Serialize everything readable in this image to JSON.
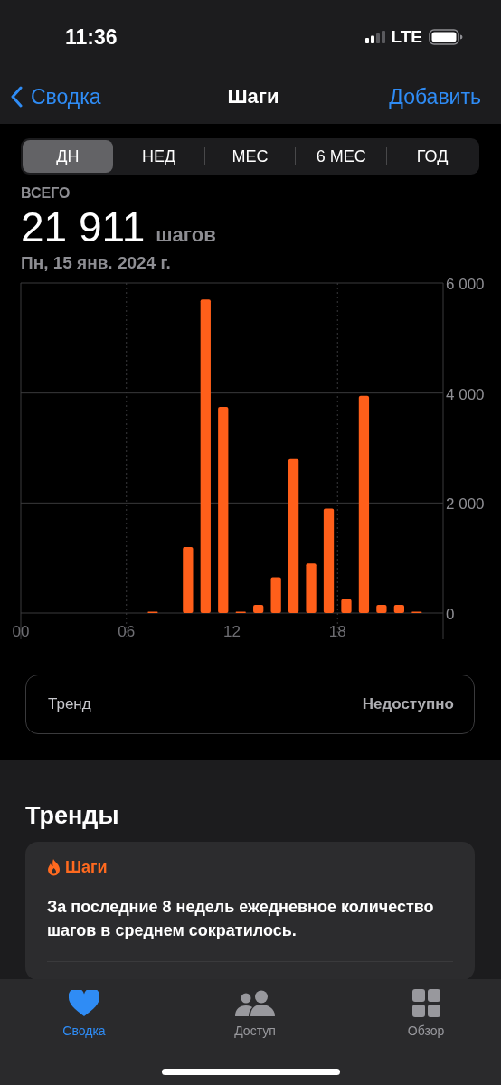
{
  "status_bar": {
    "time": "11:36",
    "network": "LTE"
  },
  "nav": {
    "back": "Сводка",
    "title": "Шаги",
    "action": "Добавить"
  },
  "periods": [
    {
      "label": "ДН",
      "selected": true
    },
    {
      "label": "НЕД",
      "selected": false
    },
    {
      "label": "МЕС",
      "selected": false
    },
    {
      "label": "6 МЕС",
      "selected": false
    },
    {
      "label": "ГОД",
      "selected": false
    }
  ],
  "summary": {
    "caption": "ВСЕГО",
    "value": "21 911",
    "unit": "шагов",
    "date": "Пн, 15 янв. 2024 г."
  },
  "chart": {
    "chart_data": {
      "type": "bar",
      "x": [
        0.5,
        1.5,
        2.5,
        3.5,
        4.5,
        5.5,
        6.5,
        7.5,
        8.5,
        9.5,
        10.5,
        11.5,
        12.5,
        13.5,
        14.5,
        15.5,
        16.5,
        17.5,
        18.5,
        19.5,
        20.5,
        21.5,
        22.5,
        23.5
      ],
      "xlim": [
        0,
        24
      ],
      "grid": true,
      "series": [
        {
          "color": "#ff5f1a",
          "values": [
            0,
            0,
            0,
            0,
            0,
            0,
            0,
            10,
            0,
            1200,
            5700,
            3750,
            20,
            150,
            650,
            2800,
            900,
            1900,
            250,
            3950,
            150,
            150,
            10,
            0
          ]
        }
      ],
      "ylim": [
        0,
        6000
      ],
      "yticks": [
        {
          "value": 0,
          "label": "0"
        },
        {
          "value": 2000,
          "label": "2 000"
        },
        {
          "value": 4000,
          "label": "4 000"
        },
        {
          "value": 6000,
          "label": "6 000"
        }
      ],
      "xticks": [
        {
          "value": 0,
          "label": "00"
        },
        {
          "value": 6,
          "label": "06"
        },
        {
          "value": 12,
          "label": "12"
        },
        {
          "value": 18,
          "label": "18"
        }
      ]
    }
  },
  "trend_row": {
    "label": "Тренд",
    "value": "Недоступно"
  },
  "trends": {
    "title": "Тренды",
    "cards": [
      {
        "category": "Шаги",
        "text": "За последние 8 недель ежедневное количество шагов в среднем сократилось."
      }
    ]
  },
  "tab_bar": [
    {
      "label": "Сводка",
      "kind": "heart",
      "selected": true
    },
    {
      "label": "Доступ",
      "kind": "people",
      "selected": false
    },
    {
      "label": "Обзор",
      "kind": "grid",
      "selected": false
    }
  ]
}
